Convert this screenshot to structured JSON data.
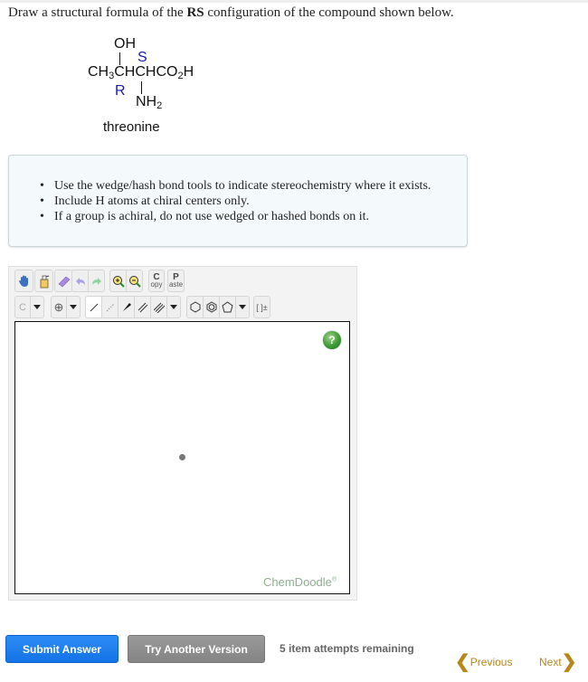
{
  "question": {
    "prefix": "Draw a structural formula of the ",
    "bold": "RS",
    "suffix": " configuration of the compound shown below."
  },
  "molecule": {
    "top_group": "OH",
    "left": "CH",
    "left_sub": "3",
    "chain": "CHCHCO",
    "chain_sub": "2",
    "chain_end": "H",
    "bottom_group": "NH",
    "bottom_sub": "2",
    "label_s": "S",
    "label_r": "R",
    "name": "threonine",
    "stereo_label_color": "#1a1aa8"
  },
  "hints": [
    "Use the wedge/hash bond tools to indicate stereochemistry where it exists.",
    "Include H atoms at chiral centers only.",
    "If a group is achiral, do not use wedged or hashed bonds on it."
  ],
  "sketcher": {
    "toolbar_row1": [
      {
        "name": "hand-icon",
        "tooltip": "Pan"
      },
      {
        "name": "eraser-bottle-icon",
        "tooltip": "Clear"
      },
      {
        "name": "eraser-icon",
        "tooltip": "Erase"
      },
      {
        "name": "undo-icon",
        "tooltip": "Undo"
      },
      {
        "name": "redo-icon",
        "tooltip": "Redo"
      },
      {
        "name": "zoom-in-icon",
        "tooltip": "Zoom In"
      },
      {
        "name": "zoom-out-icon",
        "tooltip": "Zoom Out"
      }
    ],
    "copy_label_top": "C",
    "copy_label_bottom": "opy",
    "paste_label_top": "P",
    "paste_label_bottom": "aste",
    "atom_label": "C",
    "charge_label": "⊕",
    "bracket_label": "[ ]±",
    "brand": "ChemDoodle",
    "brand_mark": "®",
    "help_label": "?"
  },
  "actions": {
    "submit": "Submit Answer",
    "try_another": "Try Another Version",
    "attempts": "5 item attempts remaining"
  },
  "nav": {
    "previous": "Previous",
    "next": "Next",
    "accent_color": "#b8861a"
  }
}
